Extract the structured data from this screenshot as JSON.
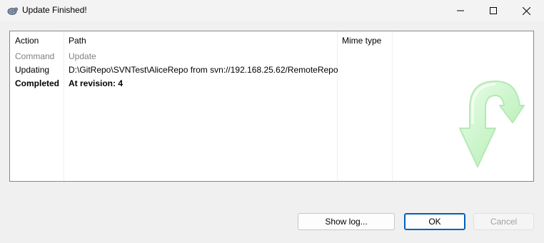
{
  "window": {
    "title": "Update Finished!",
    "app_icon": "tortoisesvn-icon"
  },
  "columns": [
    "Action",
    "Path",
    "Mime type"
  ],
  "rows": [
    {
      "action": "Command",
      "path": "Update",
      "style": "gray"
    },
    {
      "action": "Updating",
      "path": "D:\\GitRepo\\SVNTest\\AliceRepo from svn://192.168.25.62/RemoteRepo",
      "style": "normal"
    },
    {
      "action": "Completed",
      "path": "At revision: 4",
      "style": "bold"
    }
  ],
  "buttons": {
    "show_log": "Show log...",
    "ok": "OK",
    "cancel": "Cancel"
  },
  "colors": {
    "accent": "#005fb8",
    "arrow": "#c8f5c8"
  }
}
